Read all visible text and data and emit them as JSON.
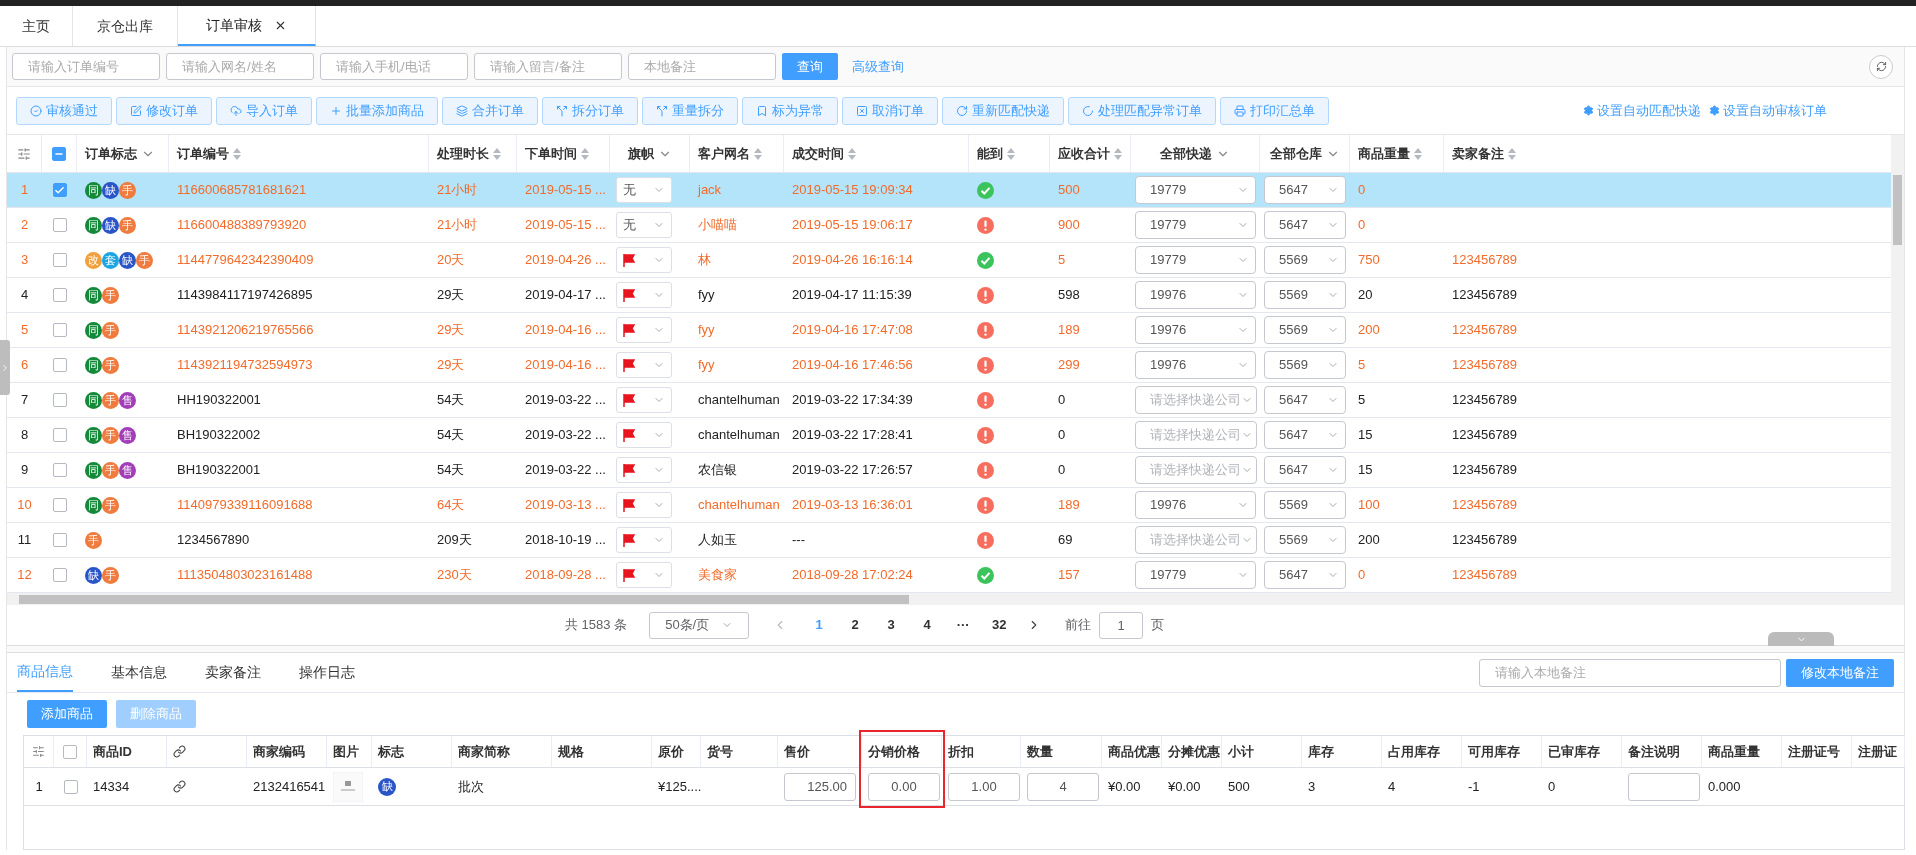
{
  "tabs": [
    {
      "label": "主页",
      "selected": false,
      "closable": false
    },
    {
      "label": "京仓出库",
      "selected": false,
      "closable": false
    },
    {
      "label": "订单审核",
      "selected": true,
      "closable": true
    }
  ],
  "filters": [
    {
      "placeholder": "请输入订单编号"
    },
    {
      "placeholder": "请输入网名/姓名"
    },
    {
      "placeholder": "请输入手机/电话"
    },
    {
      "placeholder": "请输入留言/备注"
    },
    {
      "placeholder": "本地备注"
    }
  ],
  "search_button": "查询",
  "advanced_link": "高级查询",
  "actions": [
    "审核通过",
    "修改订单",
    "导入订单",
    "批量添加商品",
    "合并订单",
    "拆分订单",
    "重量拆分",
    "标为异常",
    "取消订单",
    "重新匹配快递",
    "处理匹配异常订单",
    "打印汇总单"
  ],
  "settings_links": [
    "设置自动匹配快递",
    "设置自动审核订单"
  ],
  "orders": {
    "header_checkbox": {
      "indeterminate": true
    },
    "columns": [
      {
        "label": "订单标志",
        "kind": "filter"
      },
      {
        "label": "订单编号",
        "kind": "sort"
      },
      {
        "label": "处理时长",
        "kind": "sort"
      },
      {
        "label": "下单时间",
        "kind": "sort"
      },
      {
        "label": "旗帜",
        "kind": "filter"
      },
      {
        "label": "客户网名",
        "kind": "sort"
      },
      {
        "label": "成交时间",
        "kind": "sort"
      },
      {
        "label": "能到",
        "kind": "sort"
      },
      {
        "label": "应收合计",
        "kind": "sort"
      },
      {
        "label": "全部快递",
        "kind": "filter"
      },
      {
        "label": "全部仓库",
        "kind": "filter"
      },
      {
        "label": "商品重量",
        "kind": "sort"
      },
      {
        "label": "卖家备注",
        "kind": "sort"
      }
    ],
    "rows": [
      {
        "number": "1",
        "selected": true,
        "checked": true,
        "highlighted": true,
        "tags": [
          {
            "text": "同",
            "color": "#15893a"
          },
          {
            "text": "缺",
            "color": "#2a55c9"
          },
          {
            "text": "手",
            "color": "#ef7b3e"
          }
        ],
        "order_no": "116600685781681621",
        "duration": "21小时",
        "order_time": "2019-05-15 ...",
        "flag": {
          "kind": "none",
          "text": "无"
        },
        "customer": "jack",
        "deal_time": "2019-05-15 19:09:34",
        "reachable": true,
        "receivable": "500",
        "express": {
          "value": "19779"
        },
        "warehouse": "5647",
        "weight": "0"
      },
      {
        "number": "2",
        "selected": false,
        "checked": false,
        "highlighted": true,
        "tags": [
          {
            "text": "同",
            "color": "#15893a"
          },
          {
            "text": "缺",
            "color": "#2a55c9"
          },
          {
            "text": "手",
            "color": "#ef7b3e"
          }
        ],
        "order_no": "116600488389793920",
        "duration": "21小时",
        "order_time": "2019-05-15 ...",
        "flag": {
          "kind": "none",
          "text": "无"
        },
        "customer": "小喵喵",
        "deal_time": "2019-05-15 19:06:17",
        "reachable": false,
        "receivable": "900",
        "express": {
          "value": "19779"
        },
        "warehouse": "5647",
        "weight": "0"
      },
      {
        "number": "3",
        "selected": false,
        "checked": false,
        "highlighted": true,
        "tags": [
          {
            "text": "改",
            "color": "#f0a03c"
          },
          {
            "text": "套",
            "color": "#1ba6e2"
          },
          {
            "text": "缺",
            "color": "#2a55c9"
          },
          {
            "text": "手",
            "color": "#ef7b3e"
          }
        ],
        "order_no": "1144779642342390409",
        "duration": "20天",
        "order_time": "2019-04-26 ...",
        "flag": {
          "kind": "red"
        },
        "customer": "林",
        "deal_time": "2019-04-26 16:16:14",
        "reachable": true,
        "receivable": "5",
        "express": {
          "value": "19779"
        },
        "warehouse": "5569",
        "weight": "750",
        "seller_note": "123456789"
      },
      {
        "number": "4",
        "selected": false,
        "checked": false,
        "highlighted": false,
        "tags": [
          {
            "text": "同",
            "color": "#15893a"
          },
          {
            "text": "手",
            "color": "#ef7b3e"
          }
        ],
        "order_no": "1143984117197426895",
        "duration": "29天",
        "order_time": "2019-04-17 ...",
        "flag": {
          "kind": "red"
        },
        "customer": "fyy",
        "deal_time": "2019-04-17 11:15:39",
        "reachable": false,
        "receivable": "598",
        "express": {
          "value": "19976"
        },
        "warehouse": "5569",
        "weight": "20",
        "seller_note": "123456789"
      },
      {
        "number": "5",
        "selected": false,
        "checked": false,
        "highlighted": true,
        "tags": [
          {
            "text": "同",
            "color": "#15893a"
          },
          {
            "text": "手",
            "color": "#ef7b3e"
          }
        ],
        "order_no": "1143921206219765566",
        "duration": "29天",
        "order_time": "2019-04-16 ...",
        "flag": {
          "kind": "red"
        },
        "customer": "fyy",
        "deal_time": "2019-04-16 17:47:08",
        "reachable": false,
        "receivable": "189",
        "express": {
          "value": "19976"
        },
        "warehouse": "5569",
        "weight": "200",
        "seller_note": "123456789"
      },
      {
        "number": "6",
        "selected": false,
        "checked": false,
        "highlighted": true,
        "tags": [
          {
            "text": "同",
            "color": "#15893a"
          },
          {
            "text": "手",
            "color": "#ef7b3e"
          }
        ],
        "order_no": "1143921194732594973",
        "duration": "29天",
        "order_time": "2019-04-16 ...",
        "flag": {
          "kind": "red"
        },
        "customer": "fyy",
        "deal_time": "2019-04-16 17:46:56",
        "reachable": false,
        "receivable": "299",
        "express": {
          "value": "19976"
        },
        "warehouse": "5569",
        "weight": "5",
        "seller_note": "123456789"
      },
      {
        "number": "7",
        "selected": false,
        "checked": false,
        "highlighted": false,
        "tags": [
          {
            "text": "同",
            "color": "#15893a"
          },
          {
            "text": "手",
            "color": "#ef7b3e"
          },
          {
            "text": "售",
            "color": "#a23fb8"
          }
        ],
        "order_no": "HH190322001",
        "duration": "54天",
        "order_time": "2019-03-22 ...",
        "flag": {
          "kind": "red"
        },
        "customer": "chantelhuman",
        "deal_time": "2019-03-22 17:34:39",
        "reachable": false,
        "receivable": "0",
        "express": {
          "placeholder": "请选择快递公司"
        },
        "warehouse": "5647",
        "weight": "5",
        "seller_note": "123456789"
      },
      {
        "number": "8",
        "selected": false,
        "checked": false,
        "highlighted": false,
        "tags": [
          {
            "text": "同",
            "color": "#15893a"
          },
          {
            "text": "手",
            "color": "#ef7b3e"
          },
          {
            "text": "售",
            "color": "#a23fb8"
          }
        ],
        "order_no": "BH190322002",
        "duration": "54天",
        "order_time": "2019-03-22 ...",
        "flag": {
          "kind": "red"
        },
        "customer": "chantelhuman",
        "deal_time": "2019-03-22 17:28:41",
        "reachable": false,
        "receivable": "0",
        "express": {
          "placeholder": "请选择快递公司"
        },
        "warehouse": "5647",
        "weight": "15",
        "seller_note": "123456789"
      },
      {
        "number": "9",
        "selected": false,
        "checked": false,
        "highlighted": false,
        "tags": [
          {
            "text": "同",
            "color": "#15893a"
          },
          {
            "text": "手",
            "color": "#ef7b3e"
          },
          {
            "text": "售",
            "color": "#a23fb8"
          }
        ],
        "order_no": "BH190322001",
        "duration": "54天",
        "order_time": "2019-03-22 ...",
        "flag": {
          "kind": "red"
        },
        "customer": "农信银",
        "deal_time": "2019-03-22 17:26:57",
        "reachable": false,
        "receivable": "0",
        "express": {
          "placeholder": "请选择快递公司"
        },
        "warehouse": "5647",
        "weight": "15",
        "seller_note": "123456789"
      },
      {
        "number": "10",
        "selected": false,
        "checked": false,
        "highlighted": true,
        "tags": [
          {
            "text": "同",
            "color": "#15893a"
          },
          {
            "text": "手",
            "color": "#ef7b3e"
          }
        ],
        "order_no": "1140979339116091688",
        "duration": "64天",
        "order_time": "2019-03-13 ...",
        "flag": {
          "kind": "red"
        },
        "customer": "chantelhuman",
        "deal_time": "2019-03-13 16:36:01",
        "reachable": false,
        "receivable": "189",
        "express": {
          "value": "19976"
        },
        "warehouse": "5569",
        "weight": "100",
        "seller_note": "123456789"
      },
      {
        "number": "11",
        "selected": false,
        "checked": false,
        "highlighted": false,
        "tags": [
          {
            "text": "手",
            "color": "#ef7b3e"
          }
        ],
        "order_no": "1234567890",
        "duration": "209天",
        "order_time": "2018-10-19 ...",
        "flag": {
          "kind": "red"
        },
        "customer": "人如玉",
        "deal_time": "---",
        "reachable": false,
        "receivable": "69",
        "express": {
          "placeholder": "请选择快递公司"
        },
        "warehouse": "5569",
        "weight": "200",
        "seller_note": "123456789"
      },
      {
        "number": "12",
        "selected": false,
        "checked": false,
        "highlighted": true,
        "tags": [
          {
            "text": "缺",
            "color": "#2a55c9"
          },
          {
            "text": "手",
            "color": "#ef7b3e"
          }
        ],
        "order_no": "1113504803023161488",
        "duration": "230天",
        "order_time": "2018-09-28 ...",
        "flag": {
          "kind": "red"
        },
        "customer": "美食家",
        "deal_time": "2018-09-28 17:02:24",
        "reachable": true,
        "receivable": "157",
        "express": {
          "value": "19779"
        },
        "warehouse": "5647",
        "weight": "0",
        "seller_note": "123456789"
      }
    ]
  },
  "pagination": {
    "total": "共 1583 条",
    "page_size": "50条/页",
    "pages": [
      {
        "label": "1",
        "selected": true
      },
      {
        "label": "2",
        "selected": false
      },
      {
        "label": "3",
        "selected": false
      },
      {
        "label": "4",
        "selected": false
      },
      {
        "label": "···",
        "selected": false
      },
      {
        "label": "32",
        "selected": false
      }
    ],
    "goto_label": "前往",
    "goto_value": "1",
    "goto_suffix": "页"
  },
  "detail": {
    "tabs": [
      {
        "label": "商品信息",
        "selected": true
      },
      {
        "label": "基本信息",
        "selected": false
      },
      {
        "label": "卖家备注",
        "selected": false
      },
      {
        "label": "操作日志",
        "selected": false
      }
    ],
    "note_placeholder": "请输入本地备注",
    "note_button": "修改本地备注",
    "buttons": [
      {
        "label": "添加商品",
        "disabled": false
      },
      {
        "label": "删除商品",
        "disabled": true
      }
    ],
    "columns": [
      {
        "kind": "settings"
      },
      {
        "kind": "checkbox",
        "checked": false
      },
      {
        "kind": "text",
        "label": "商品ID"
      },
      {
        "kind": "link"
      },
      {
        "kind": "text",
        "label": "商家编码"
      },
      {
        "kind": "text",
        "label": "图片"
      },
      {
        "kind": "text",
        "label": "标志"
      },
      {
        "kind": "text",
        "label": "商家简称"
      },
      {
        "kind": "text",
        "label": "规格"
      },
      {
        "kind": "text",
        "label": "原价"
      },
      {
        "kind": "text",
        "label": "货号"
      },
      {
        "kind": "text",
        "label": "售价"
      },
      {
        "kind": "text",
        "label": "分销价格",
        "highlighted": true
      },
      {
        "kind": "text",
        "label": "折扣"
      },
      {
        "kind": "text",
        "label": "数量"
      },
      {
        "kind": "text",
        "label": "商品优惠"
      },
      {
        "kind": "text",
        "label": "分摊优惠"
      },
      {
        "kind": "text",
        "label": "小计"
      },
      {
        "kind": "text",
        "label": "库存"
      },
      {
        "kind": "text",
        "label": "占用库存"
      },
      {
        "kind": "text",
        "label": "可用库存"
      },
      {
        "kind": "text",
        "label": "已审库存"
      },
      {
        "kind": "text",
        "label": "备注说明"
      },
      {
        "kind": "text",
        "label": "商品重量"
      },
      {
        "kind": "text",
        "label": "注册证号"
      },
      {
        "kind": "text",
        "label": "注册证"
      }
    ],
    "rows": [
      {
        "cells": [
          {
            "kind": "text",
            "text": "1"
          },
          {
            "kind": "checkbox",
            "checked": false
          },
          {
            "kind": "text",
            "text": "14334"
          },
          {
            "kind": "link"
          },
          {
            "kind": "text",
            "text": "2132416541"
          },
          {
            "kind": "picture"
          },
          {
            "kind": "tag",
            "text": "缺",
            "color": "#2a55c9"
          },
          {
            "kind": "text",
            "text": "批次"
          },
          {
            "kind": "blank"
          },
          {
            "kind": "text",
            "text": "¥125...."
          },
          {
            "kind": "blank"
          },
          {
            "kind": "input",
            "value": "125.00",
            "right_aligned": true
          },
          {
            "kind": "input",
            "value": "0.00"
          },
          {
            "kind": "input",
            "value": "1.00"
          },
          {
            "kind": "input",
            "value": "4"
          },
          {
            "kind": "text",
            "text": "¥0.00"
          },
          {
            "kind": "text",
            "text": "¥0.00"
          },
          {
            "kind": "text",
            "text": "500"
          },
          {
            "kind": "text",
            "text": "3"
          },
          {
            "kind": "text",
            "text": "4"
          },
          {
            "kind": "text",
            "text": "-1"
          },
          {
            "kind": "text",
            "text": "0"
          },
          {
            "kind": "input"
          },
          {
            "kind": "text",
            "text": "0.000"
          },
          {
            "kind": "blank"
          },
          {
            "kind": "blank"
          }
        ]
      }
    ]
  }
}
